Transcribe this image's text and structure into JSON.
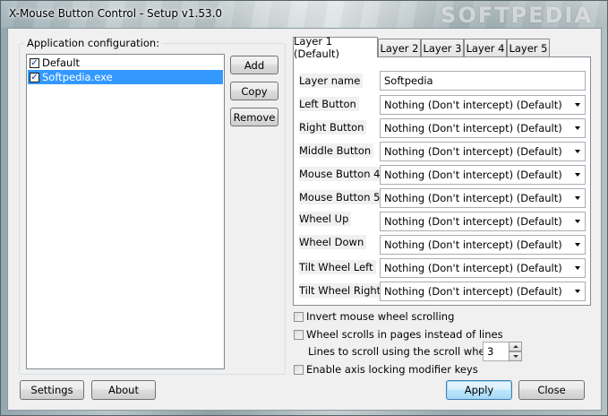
{
  "window": {
    "title": "X-Mouse Button Control - Setup v1.53.0",
    "watermark": "SOFTPEDIA"
  },
  "app_config": {
    "label": "Application configuration:",
    "items": [
      {
        "label": "Default",
        "checked": true,
        "selected": false
      },
      {
        "label": "Softpedia.exe",
        "checked": true,
        "selected": true
      }
    ],
    "buttons": {
      "add": "Add",
      "copy": "Copy",
      "remove": "Remove"
    }
  },
  "tabs": [
    {
      "label": "Layer 1 (Default)",
      "active": true
    },
    {
      "label": "Layer 2",
      "active": false
    },
    {
      "label": "Layer 3",
      "active": false
    },
    {
      "label": "Layer 4",
      "active": false
    },
    {
      "label": "Layer 5",
      "active": false
    }
  ],
  "layer": {
    "name_label": "Layer name",
    "name_value": "Softpedia",
    "rows": [
      {
        "label": "Left Button",
        "value": "Nothing (Don't intercept) (Default)"
      },
      {
        "label": "Right Button",
        "value": "Nothing (Don't intercept) (Default)"
      },
      {
        "label": "Middle Button",
        "value": "Nothing (Don't intercept) (Default)"
      },
      {
        "label": "Mouse Button 4",
        "value": "Nothing (Don't intercept) (Default)"
      },
      {
        "label": "Mouse Button 5",
        "value": "Nothing (Don't intercept) (Default)"
      },
      {
        "label": "Wheel Up",
        "value": "Nothing (Don't intercept) (Default)"
      },
      {
        "label": "Wheel Down",
        "value": "Nothing (Don't intercept) (Default)"
      },
      {
        "label": "Tilt Wheel Left",
        "value": "Nothing (Don't intercept) (Default)"
      },
      {
        "label": "Tilt Wheel Right",
        "value": "Nothing (Don't intercept) (Default)"
      }
    ]
  },
  "options": {
    "invert_scroll": {
      "label": "Invert mouse wheel scrolling",
      "checked": false
    },
    "scroll_pages": {
      "label": "Wheel scrolls in pages instead of lines",
      "checked": false
    },
    "lines_label": "Lines to scroll using the scroll wheel:",
    "lines_value": "3",
    "axis_locking": {
      "label": "Enable axis locking modifier keys",
      "checked": false
    }
  },
  "footer": {
    "settings": "Settings",
    "about": "About",
    "apply": "Apply",
    "close": "Close"
  }
}
